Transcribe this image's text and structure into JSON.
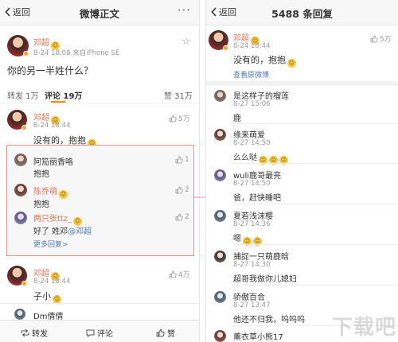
{
  "left": {
    "nav": {
      "back": "返回",
      "title": "微博正文",
      "more": "···"
    },
    "post": {
      "author": "邓超",
      "time": "8-24 18:08",
      "source": "来自iPhone SE",
      "text": "你的另一半姓什么？"
    },
    "tabs": {
      "repost": "转发 1万",
      "comment": "评论 19万",
      "like": "赞 31万"
    },
    "top_comment": {
      "author": "邓超",
      "time": "8-24 18:44",
      "likes": "5万",
      "text": "没有的，抱抱"
    },
    "replies": [
      {
        "author": "阿笳丽香咯",
        "text": "抱抱",
        "likes": "1"
      },
      {
        "author": "陈乔萌",
        "text": "抱抱",
        "likes": "2"
      },
      {
        "author": "两只张ttz_",
        "text": "好了 姓邓",
        "mention": "@邓超",
        "likes": "2"
      }
    ],
    "more_replies": "更多回复>",
    "second_comment": {
      "author": "邓超",
      "time": "8-24 18:44",
      "likes": "4万",
      "text": "子小"
    },
    "third_comment": {
      "author": "Dm倩倩"
    },
    "bottom": {
      "repost": "转发",
      "comment": "评论",
      "like": "赞"
    }
  },
  "right": {
    "nav": {
      "back": "返回",
      "title": "5488 条回复"
    },
    "main": {
      "author": "邓超",
      "time": "8-24 18:44",
      "likes": "5万",
      "text": "没有的，抱抱",
      "view_original": "查看原微博"
    },
    "replies": [
      {
        "author": "是这样子的榴莲",
        "time": "8-27 15:06",
        "text": "鹿"
      },
      {
        "author": "缘来萌爱",
        "time": "8-27 14:50",
        "text": "么么哒"
      },
      {
        "author": "wuli鹿哥最亮",
        "time": "8-27 14:50",
        "text": "爸，赶快睡吧"
      },
      {
        "author": "夏若浅沫樱",
        "time": "8-27 14:36",
        "text": "嗯"
      },
      {
        "author": "捕捉一只萌鹿晗",
        "time": "8-27 14:30",
        "text": "超哥我做你儿媳妇"
      },
      {
        "author": "骄傲百合",
        "time": "8-27 13:47",
        "text": "他还不归我，呜呜呜"
      },
      {
        "author": "薰衣草小熊17"
      }
    ],
    "watermark": "下载吧"
  },
  "colors": {
    "name_orange": "#eb7350",
    "link_blue": "#507daf",
    "highlight_border": "#e5928c",
    "tab_accent": "#ff8200"
  }
}
